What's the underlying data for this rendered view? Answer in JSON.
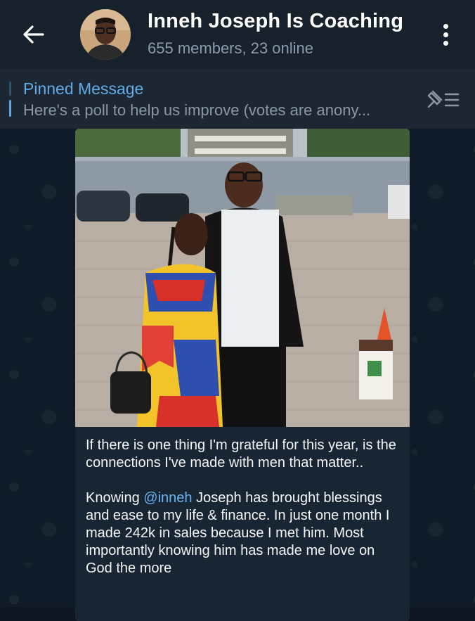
{
  "header": {
    "title": "Inneh Joseph Is Coaching",
    "subtitle": "655 members, 23 online"
  },
  "pinned": {
    "label": "Pinned Message",
    "preview": "Here's a poll to help us improve (votes are anony..."
  },
  "message": {
    "caption_part1": "If there is one thing I'm grateful for this year, is the connections I've made with men that matter..\n\nKnowing ",
    "mention": "@inneh",
    "caption_part2": " Joseph has brought blessings and ease to my life & finance. In just one month I made 242k in sales because I met him. Most importantly knowing him has made me love on God the more"
  },
  "colors": {
    "header_bg": "#17212b",
    "pinned_bg": "#1c2733",
    "accent": "#62abe6",
    "bubble_bg": "#182533",
    "chat_bg": "#0e1621"
  },
  "icons": {
    "back": "arrow-left-icon",
    "menu": "more-vertical-icon",
    "pin_list": "pin-list-icon"
  }
}
